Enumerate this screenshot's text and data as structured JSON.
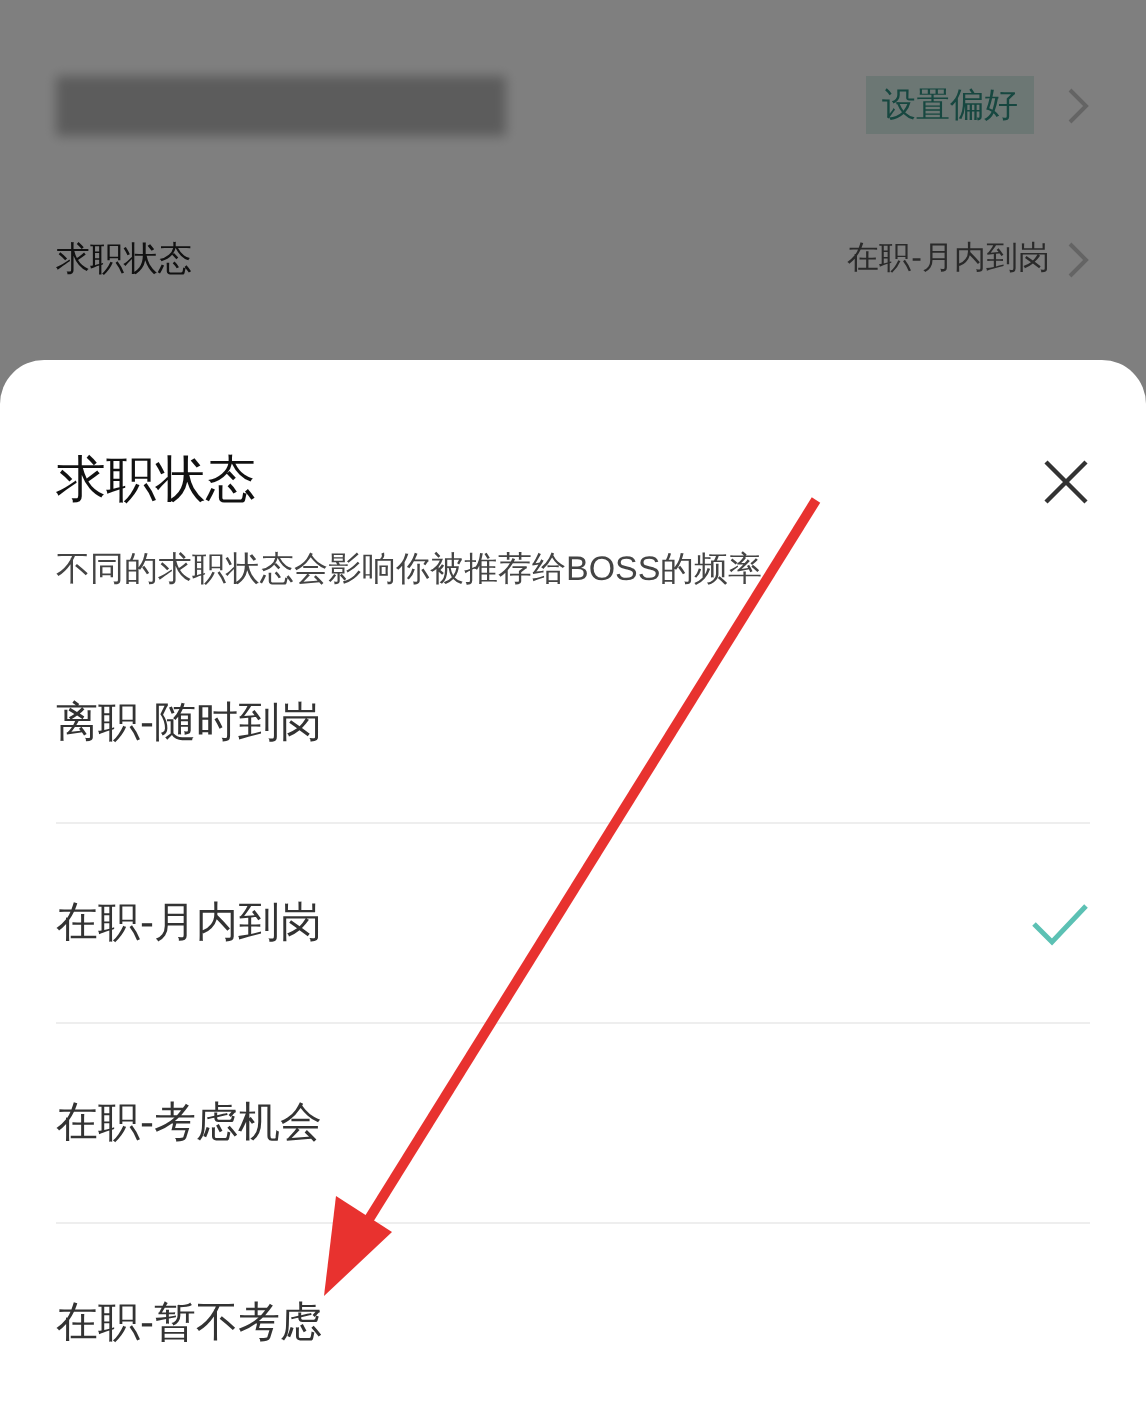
{
  "background": {
    "preference_tag": "设置偏好",
    "status_row": {
      "label": "求职状态",
      "value": "在职-月内到岗"
    }
  },
  "sheet": {
    "title": "求职状态",
    "subtitle": "不同的求职状态会影响你被推荐给BOSS的频率",
    "options": [
      {
        "label": "离职-随时到岗",
        "selected": false
      },
      {
        "label": "在职-月内到岗",
        "selected": true
      },
      {
        "label": "在职-考虑机会",
        "selected": false
      },
      {
        "label": "在职-暂不考虑",
        "selected": false
      }
    ]
  }
}
